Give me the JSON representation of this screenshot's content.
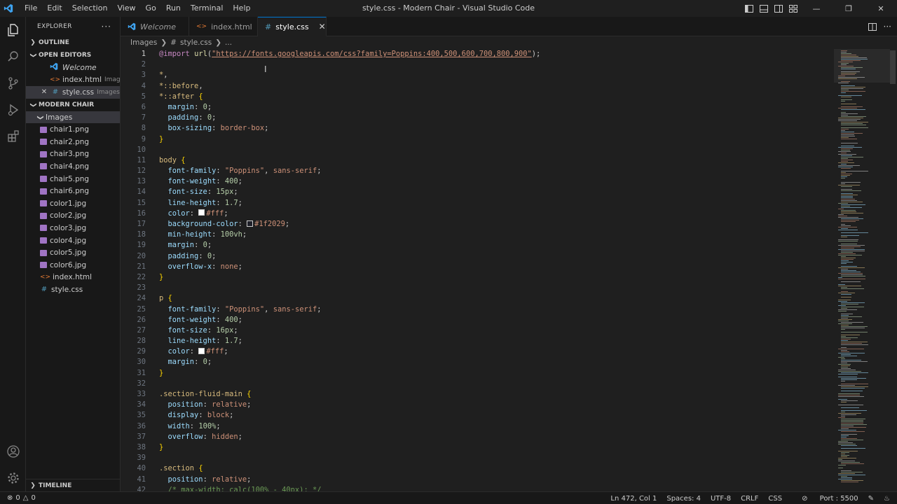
{
  "window": {
    "title": "style.css - Modern Chair - Visual Studio Code",
    "menu": [
      "File",
      "Edit",
      "Selection",
      "View",
      "Go",
      "Run",
      "Terminal",
      "Help"
    ]
  },
  "sidebar": {
    "header": "EXPLORER",
    "outline": "OUTLINE",
    "open_editors": "OPEN EDITORS",
    "open_editor_items": [
      {
        "label": "Welcome",
        "desc": ""
      },
      {
        "label": "index.html",
        "desc": "Images"
      },
      {
        "label": "style.css",
        "desc": "Images"
      }
    ],
    "project": "MODERN CHAIR",
    "folder": "Images",
    "files": [
      "chair1.png",
      "chair2.png",
      "chair3.png",
      "chair4.png",
      "chair5.png",
      "chair6.png",
      "color1.jpg",
      "color2.jpg",
      "color3.jpg",
      "color4.jpg",
      "color5.jpg",
      "color6.jpg",
      "index.html",
      "style.css"
    ],
    "timeline": "TIMELINE"
  },
  "tabs": [
    {
      "label": "Welcome"
    },
    {
      "label": "index.html"
    },
    {
      "label": "style.css"
    }
  ],
  "breadcrumb": {
    "folder": "Images",
    "file": "style.css",
    "symbol": "..."
  },
  "status": {
    "problems": "0",
    "warnings": "0",
    "position": "Ln 472, Col 1",
    "spaces": "Spaces: 4",
    "encoding": "UTF-8",
    "eol": "CRLF",
    "language": "CSS",
    "port": "Port : 5500"
  },
  "colors": {
    "accent": "#0078d4",
    "editor_bg": "#1f1f1f",
    "sidebar_bg": "#181818"
  }
}
